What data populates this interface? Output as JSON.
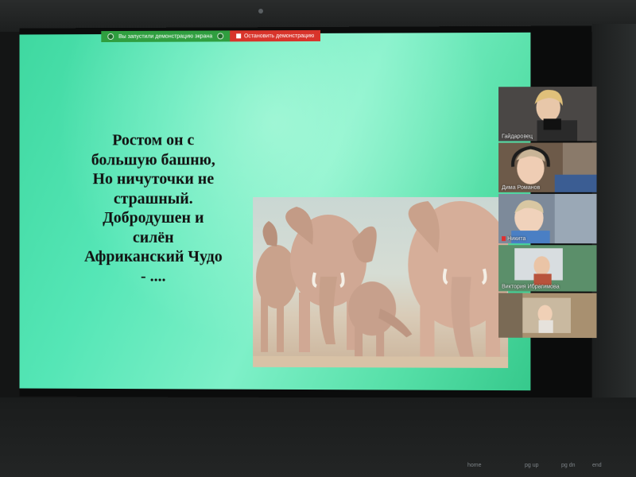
{
  "share_bar": {
    "status": "Вы запустили демонстрацию экрана",
    "stop_label": "Остановить демонстрацию",
    "status_color": "#2f9e3f",
    "stop_color": "#d8342b"
  },
  "slide": {
    "lines": [
      "Ростом он с",
      "большую башню,",
      "Но ничуточки не",
      "страшный.",
      "Добродушен и",
      "силён",
      "Африканский Чудо",
      "- ...."
    ],
    "background": "#5ce6b6"
  },
  "participants": [
    {
      "name": "Гайдаровец",
      "muted": false
    },
    {
      "name": "Дима Романов",
      "muted": false
    },
    {
      "name": "Никита",
      "muted": true
    },
    {
      "name": "Виктория Ибрагимова",
      "muted": false
    },
    {
      "name": "",
      "muted": false
    }
  ],
  "keyboard": {
    "labels": [
      "home",
      "pg up",
      "pg dn",
      "end"
    ]
  }
}
